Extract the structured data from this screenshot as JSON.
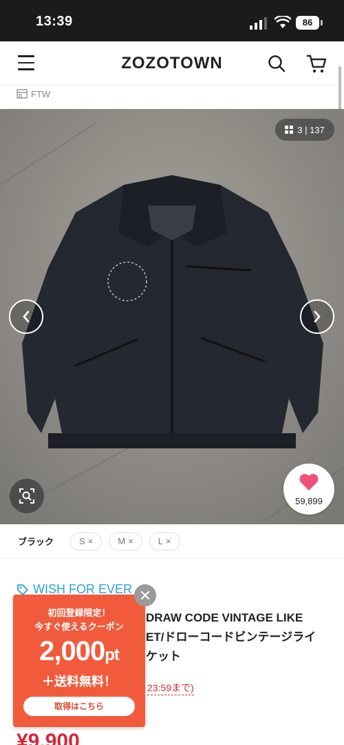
{
  "status_bar": {
    "time": "13:39",
    "battery": "86"
  },
  "header": {
    "logo": "ZOZOTOWN"
  },
  "breadcrumb": {
    "shop": "FTW"
  },
  "gallery": {
    "counter": "3 | 137",
    "favorite_count": "59,899"
  },
  "variants": {
    "color": "ブラック",
    "sizes": [
      {
        "label": "S",
        "mark": "×"
      },
      {
        "label": "M",
        "mark": "×"
      },
      {
        "label": "L",
        "mark": "×"
      }
    ]
  },
  "product": {
    "brand": "WISH FOR EVER",
    "title_lines": [
      "DRAW CODE VINTAGE LIKE",
      "ET/ドローコードビンテージライ",
      "ケット"
    ],
    "sale_text": "23:59まで)",
    "price": "¥9,900"
  },
  "coupon": {
    "line1": "初回登録限定！",
    "line2": "今すぐ使えるクーポン",
    "amount": "2,000",
    "unit": "pt",
    "line3": "＋送料無料！",
    "button": "取得はこちら"
  },
  "colors": {
    "brand": "#2aa2d6",
    "sale": "#d9253a",
    "coupon_bg": "#f25a3c",
    "heart": "#f0507a"
  },
  "icons": [
    "menu-icon",
    "search-icon",
    "cart-icon",
    "store-icon",
    "grid-icon",
    "chevron-left-icon",
    "chevron-right-icon",
    "zoom-search-icon",
    "heart-icon",
    "tag-icon",
    "close-icon"
  ]
}
